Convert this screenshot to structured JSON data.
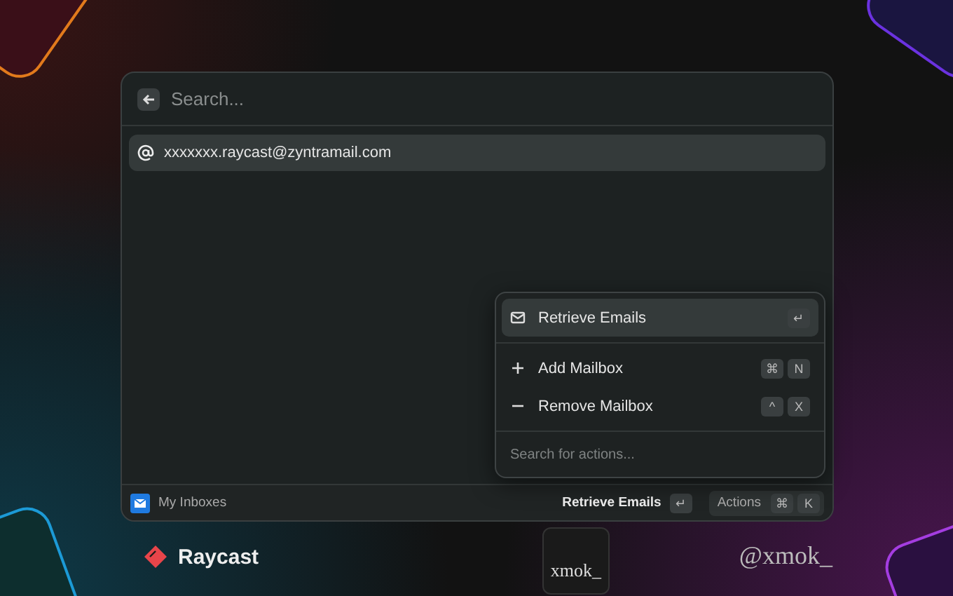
{
  "search": {
    "placeholder": "Search..."
  },
  "items": [
    {
      "label": "xxxxxxx.raycast@zyntramail.com",
      "selected": true
    }
  ],
  "actions": {
    "items": [
      {
        "kind": "mail",
        "label": "Retrieve Emails",
        "keys": [
          "↵"
        ],
        "selected": true
      },
      {
        "kind": "plus",
        "label": "Add Mailbox",
        "keys": [
          "⌘",
          "N"
        ],
        "selected": false
      },
      {
        "kind": "minus",
        "label": "Remove Mailbox",
        "keys": [
          "^",
          "X"
        ],
        "selected": false
      }
    ],
    "search_placeholder": "Search for actions..."
  },
  "footer": {
    "title": "My Inboxes",
    "primary_action": "Retrieve Emails",
    "primary_key": "↵",
    "actions_label": "Actions",
    "actions_keys": [
      "⌘",
      "K"
    ]
  },
  "branding": {
    "logo_text": "Raycast",
    "badge_text": "xmok_",
    "handle": "@xmok_"
  }
}
